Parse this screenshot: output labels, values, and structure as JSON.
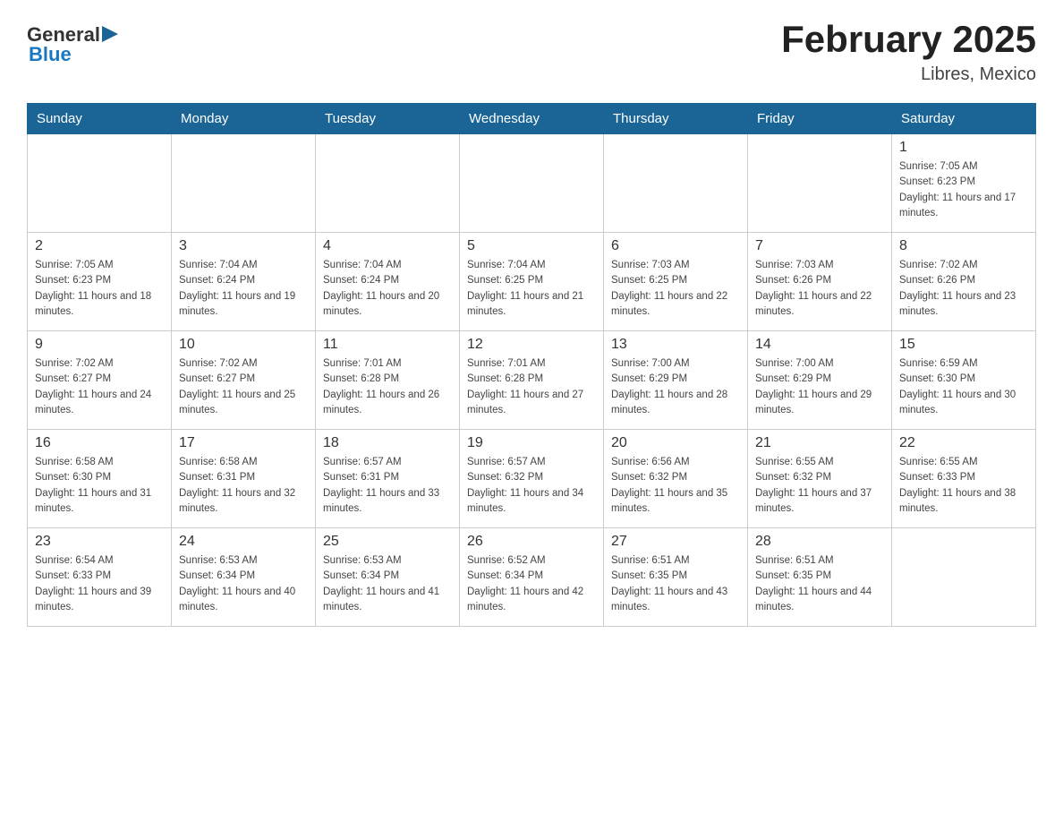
{
  "header": {
    "logo_general": "General",
    "logo_blue": "Blue",
    "month_title": "February 2025",
    "location": "Libres, Mexico"
  },
  "days_of_week": [
    "Sunday",
    "Monday",
    "Tuesday",
    "Wednesday",
    "Thursday",
    "Friday",
    "Saturday"
  ],
  "weeks": [
    [
      {
        "num": "",
        "info": ""
      },
      {
        "num": "",
        "info": ""
      },
      {
        "num": "",
        "info": ""
      },
      {
        "num": "",
        "info": ""
      },
      {
        "num": "",
        "info": ""
      },
      {
        "num": "",
        "info": ""
      },
      {
        "num": "1",
        "info": "Sunrise: 7:05 AM\nSunset: 6:23 PM\nDaylight: 11 hours and 17 minutes."
      }
    ],
    [
      {
        "num": "2",
        "info": "Sunrise: 7:05 AM\nSunset: 6:23 PM\nDaylight: 11 hours and 18 minutes."
      },
      {
        "num": "3",
        "info": "Sunrise: 7:04 AM\nSunset: 6:24 PM\nDaylight: 11 hours and 19 minutes."
      },
      {
        "num": "4",
        "info": "Sunrise: 7:04 AM\nSunset: 6:24 PM\nDaylight: 11 hours and 20 minutes."
      },
      {
        "num": "5",
        "info": "Sunrise: 7:04 AM\nSunset: 6:25 PM\nDaylight: 11 hours and 21 minutes."
      },
      {
        "num": "6",
        "info": "Sunrise: 7:03 AM\nSunset: 6:25 PM\nDaylight: 11 hours and 22 minutes."
      },
      {
        "num": "7",
        "info": "Sunrise: 7:03 AM\nSunset: 6:26 PM\nDaylight: 11 hours and 22 minutes."
      },
      {
        "num": "8",
        "info": "Sunrise: 7:02 AM\nSunset: 6:26 PM\nDaylight: 11 hours and 23 minutes."
      }
    ],
    [
      {
        "num": "9",
        "info": "Sunrise: 7:02 AM\nSunset: 6:27 PM\nDaylight: 11 hours and 24 minutes."
      },
      {
        "num": "10",
        "info": "Sunrise: 7:02 AM\nSunset: 6:27 PM\nDaylight: 11 hours and 25 minutes."
      },
      {
        "num": "11",
        "info": "Sunrise: 7:01 AM\nSunset: 6:28 PM\nDaylight: 11 hours and 26 minutes."
      },
      {
        "num": "12",
        "info": "Sunrise: 7:01 AM\nSunset: 6:28 PM\nDaylight: 11 hours and 27 minutes."
      },
      {
        "num": "13",
        "info": "Sunrise: 7:00 AM\nSunset: 6:29 PM\nDaylight: 11 hours and 28 minutes."
      },
      {
        "num": "14",
        "info": "Sunrise: 7:00 AM\nSunset: 6:29 PM\nDaylight: 11 hours and 29 minutes."
      },
      {
        "num": "15",
        "info": "Sunrise: 6:59 AM\nSunset: 6:30 PM\nDaylight: 11 hours and 30 minutes."
      }
    ],
    [
      {
        "num": "16",
        "info": "Sunrise: 6:58 AM\nSunset: 6:30 PM\nDaylight: 11 hours and 31 minutes."
      },
      {
        "num": "17",
        "info": "Sunrise: 6:58 AM\nSunset: 6:31 PM\nDaylight: 11 hours and 32 minutes."
      },
      {
        "num": "18",
        "info": "Sunrise: 6:57 AM\nSunset: 6:31 PM\nDaylight: 11 hours and 33 minutes."
      },
      {
        "num": "19",
        "info": "Sunrise: 6:57 AM\nSunset: 6:32 PM\nDaylight: 11 hours and 34 minutes."
      },
      {
        "num": "20",
        "info": "Sunrise: 6:56 AM\nSunset: 6:32 PM\nDaylight: 11 hours and 35 minutes."
      },
      {
        "num": "21",
        "info": "Sunrise: 6:55 AM\nSunset: 6:32 PM\nDaylight: 11 hours and 37 minutes."
      },
      {
        "num": "22",
        "info": "Sunrise: 6:55 AM\nSunset: 6:33 PM\nDaylight: 11 hours and 38 minutes."
      }
    ],
    [
      {
        "num": "23",
        "info": "Sunrise: 6:54 AM\nSunset: 6:33 PM\nDaylight: 11 hours and 39 minutes."
      },
      {
        "num": "24",
        "info": "Sunrise: 6:53 AM\nSunset: 6:34 PM\nDaylight: 11 hours and 40 minutes."
      },
      {
        "num": "25",
        "info": "Sunrise: 6:53 AM\nSunset: 6:34 PM\nDaylight: 11 hours and 41 minutes."
      },
      {
        "num": "26",
        "info": "Sunrise: 6:52 AM\nSunset: 6:34 PM\nDaylight: 11 hours and 42 minutes."
      },
      {
        "num": "27",
        "info": "Sunrise: 6:51 AM\nSunset: 6:35 PM\nDaylight: 11 hours and 43 minutes."
      },
      {
        "num": "28",
        "info": "Sunrise: 6:51 AM\nSunset: 6:35 PM\nDaylight: 11 hours and 44 minutes."
      },
      {
        "num": "",
        "info": ""
      }
    ]
  ]
}
